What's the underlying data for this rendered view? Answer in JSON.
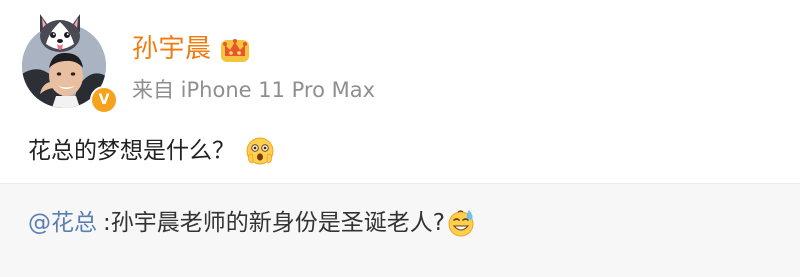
{
  "post": {
    "author": {
      "name": "孙宇晨",
      "verified_mark": "V",
      "avatar_icon": "husky-hat-avatar",
      "crown_icon": "crown-icon"
    },
    "source": "来自 iPhone 11 Pro Max",
    "text": "花总的梦想是什么？",
    "emoji": "wow-face-emoji"
  },
  "comment": {
    "user": "@花总",
    "text": ":孙宇晨老师的新身份是圣诞老人?",
    "emoji": "sweat-smile-emoji"
  },
  "colors": {
    "username": "#f07b0f",
    "source": "#8f8f8f",
    "mention": "#5a7fb3",
    "badge": "#f7a21d",
    "comment_bg": "#f7f7f7"
  }
}
